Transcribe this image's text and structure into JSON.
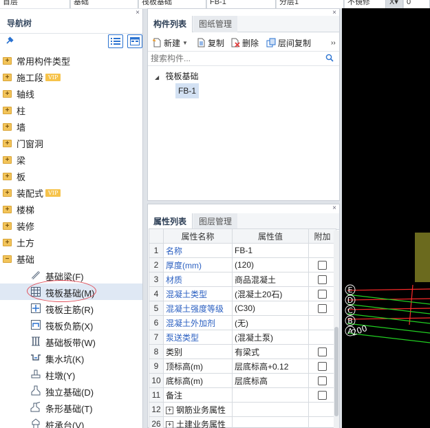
{
  "top_strip": [
    "首层",
    "基础",
    "筏板基础",
    "FB-1",
    "分层1",
    "不镜修",
    "X▾",
    "0"
  ],
  "nav": {
    "title": "导航树",
    "close_glyph": "×",
    "items": [
      {
        "label": "常用构件类型",
        "vip": false
      },
      {
        "label": "施工段",
        "vip": true
      },
      {
        "label": "轴线",
        "vip": false
      },
      {
        "label": "柱",
        "vip": false
      },
      {
        "label": "墙",
        "vip": false
      },
      {
        "label": "门窗洞",
        "vip": false
      },
      {
        "label": "梁",
        "vip": false
      },
      {
        "label": "板",
        "vip": false
      },
      {
        "label": "装配式",
        "vip": true
      },
      {
        "label": "楼梯",
        "vip": false
      },
      {
        "label": "装修",
        "vip": false
      },
      {
        "label": "土方",
        "vip": false
      },
      {
        "label": "基础",
        "vip": false
      }
    ],
    "vip_label": "VIP",
    "sub_items": [
      {
        "label": "基础梁(F)",
        "icon": "beam-icon"
      },
      {
        "label": "筏板基础(M)",
        "icon": "raft-icon"
      },
      {
        "label": "筏板主筋(R)",
        "icon": "rebar-main-icon"
      },
      {
        "label": "筏板负筋(X)",
        "icon": "rebar-neg-icon"
      },
      {
        "label": "基础板带(W)",
        "icon": "strip-icon"
      },
      {
        "label": "集水坑(K)",
        "icon": "sump-icon"
      },
      {
        "label": "柱墩(Y)",
        "icon": "pier-icon"
      },
      {
        "label": "独立基础(D)",
        "icon": "isolated-footing-icon"
      },
      {
        "label": "条形基础(T)",
        "icon": "strip-footing-icon"
      },
      {
        "label": "桩承台(V)",
        "icon": "pile-cap-icon"
      }
    ]
  },
  "component_panel": {
    "tabs": [
      "构件列表",
      "图纸管理"
    ],
    "toolbar": {
      "new": "新建",
      "copy": "复制",
      "delete": "删除",
      "floor_copy": "层间复制",
      "more": "››"
    },
    "search_placeholder": "搜索构件...",
    "tree_root": "筏板基础",
    "tree_child": "FB-1"
  },
  "props_panel": {
    "tabs": [
      "属性列表",
      "图层管理"
    ],
    "headers": [
      "属性名称",
      "属性值",
      "附加"
    ],
    "rows": [
      {
        "n": "1",
        "name": "名称",
        "value": "FB-1",
        "blue": true,
        "check": false
      },
      {
        "n": "2",
        "name": "厚度(mm)",
        "value": "(120)",
        "blue": true,
        "check": true
      },
      {
        "n": "3",
        "name": "材质",
        "value": "商品混凝土",
        "blue": true,
        "check": true
      },
      {
        "n": "4",
        "name": "混凝土类型",
        "value": "(混凝土20石)",
        "blue": true,
        "check": true
      },
      {
        "n": "5",
        "name": "混凝土强度等级",
        "value": "(C30)",
        "blue": true,
        "check": true
      },
      {
        "n": "6",
        "name": "混凝土外加剂",
        "value": "(无)",
        "blue": true,
        "check": false
      },
      {
        "n": "7",
        "name": "泵送类型",
        "value": "(混凝土泵)",
        "blue": true,
        "check": false
      },
      {
        "n": "8",
        "name": "类别",
        "value": "有梁式",
        "blue": false,
        "check": true
      },
      {
        "n": "9",
        "name": "顶标高(m)",
        "value": "层底标高+0.12",
        "blue": false,
        "check": true
      },
      {
        "n": "10",
        "name": "底标高(m)",
        "value": "层底标高",
        "blue": false,
        "check": true
      },
      {
        "n": "11",
        "name": "备注",
        "value": "",
        "blue": false,
        "check": true
      },
      {
        "n": "12",
        "name": "钢筋业务属性",
        "value": "",
        "blue": false,
        "check": false,
        "group": true
      },
      {
        "n": "26",
        "name": "土建业务属性",
        "value": "",
        "blue": false,
        "check": false,
        "group": true
      }
    ]
  },
  "canvas": {
    "axis_labels": [
      "E",
      "D",
      "C",
      "B",
      "A"
    ],
    "dim_text": "200"
  }
}
